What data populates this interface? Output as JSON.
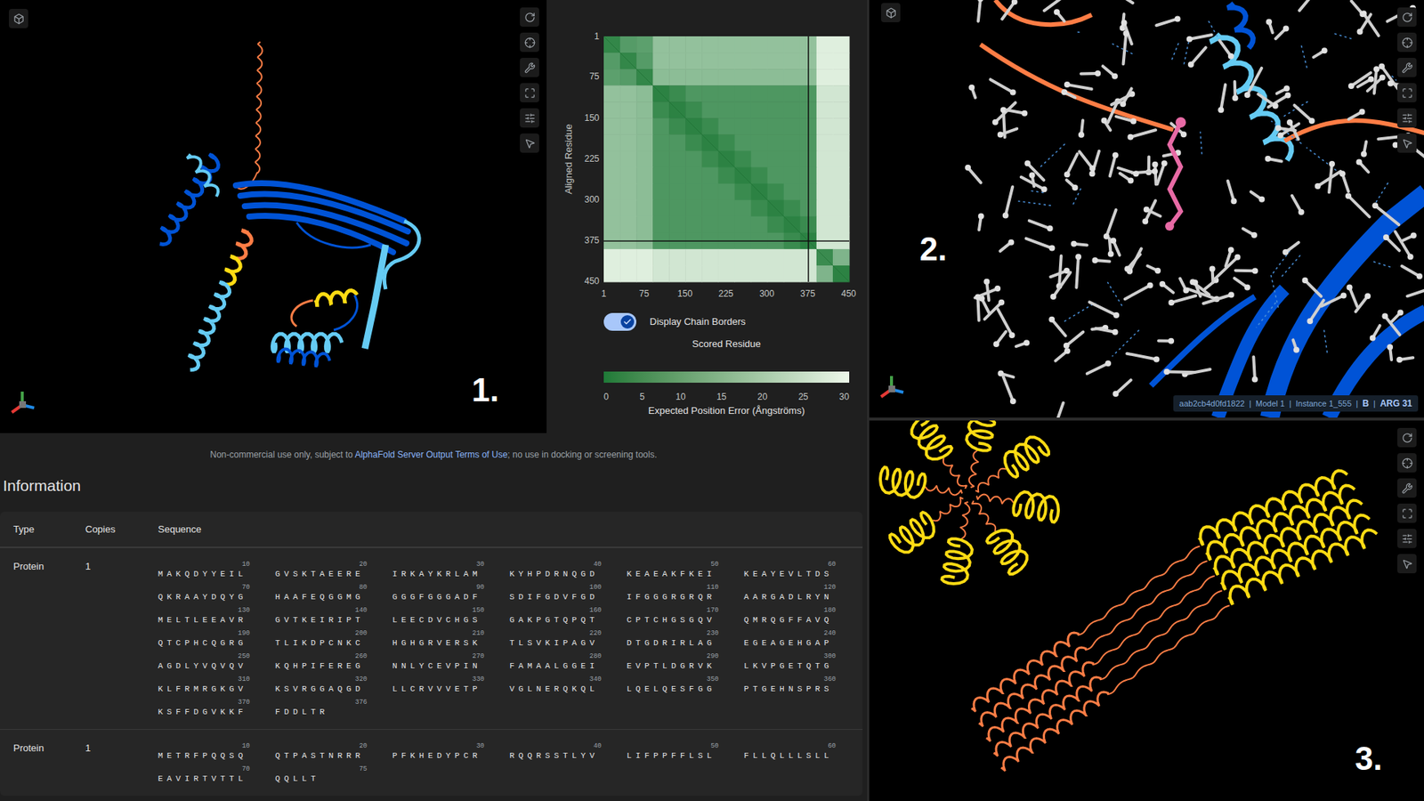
{
  "panels": [
    {
      "label": "1."
    },
    {
      "label": "2.",
      "status": {
        "separator": "|",
        "items": [
          {
            "text": "aab2cb4d0fd1822",
            "bold": false
          },
          {
            "text": "Model 1",
            "bold": false
          },
          {
            "text": "Instance 1_555",
            "bold": false
          },
          {
            "text": "B",
            "bold": true
          },
          {
            "text": "ARG 31",
            "bold": true
          }
        ]
      }
    },
    {
      "label": "3."
    }
  ],
  "pae_chart": {
    "y_label": "Aligned Residue",
    "x_label": "Scored Residue",
    "y_ticks": [
      "1",
      "75",
      "150",
      "225",
      "300",
      "375",
      "450"
    ],
    "x_ticks": [
      "1",
      "75",
      "150",
      "225",
      "300",
      "375",
      "450"
    ],
    "chain_lengths": [
      376,
      75
    ],
    "block_size": 30,
    "matrix": [
      [
        3,
        8,
        9,
        17,
        17,
        17,
        17,
        17,
        17,
        17,
        17,
        17,
        17,
        28,
        28
      ],
      [
        8,
        3,
        8,
        17,
        17,
        17,
        17,
        17,
        17,
        17,
        17,
        17,
        17,
        28,
        28
      ],
      [
        9,
        8,
        3,
        16,
        16,
        16,
        16,
        16,
        16,
        16,
        16,
        16,
        16,
        28,
        28
      ],
      [
        17,
        17,
        16,
        2,
        4,
        7,
        7,
        7,
        7,
        7,
        7,
        7,
        7,
        26,
        26
      ],
      [
        17,
        17,
        16,
        4,
        2,
        4,
        7,
        7,
        7,
        7,
        7,
        7,
        7,
        26,
        26
      ],
      [
        17,
        17,
        16,
        7,
        4,
        2,
        4,
        7,
        7,
        7,
        7,
        7,
        7,
        26,
        26
      ],
      [
        17,
        17,
        16,
        7,
        7,
        4,
        2,
        4,
        7,
        7,
        7,
        7,
        7,
        26,
        26
      ],
      [
        17,
        17,
        16,
        7,
        7,
        7,
        4,
        2,
        4,
        7,
        7,
        7,
        7,
        26,
        26
      ],
      [
        17,
        17,
        16,
        7,
        7,
        7,
        7,
        4,
        2,
        4,
        7,
        7,
        7,
        26,
        26
      ],
      [
        17,
        17,
        16,
        7,
        7,
        7,
        7,
        7,
        4,
        2,
        4,
        7,
        7,
        26,
        26
      ],
      [
        17,
        17,
        16,
        7,
        7,
        7,
        7,
        7,
        7,
        4,
        2,
        4,
        7,
        26,
        26
      ],
      [
        17,
        17,
        16,
        7,
        7,
        7,
        7,
        7,
        7,
        7,
        4,
        2,
        4,
        26,
        26
      ],
      [
        17,
        17,
        16,
        7,
        7,
        7,
        7,
        7,
        7,
        7,
        7,
        4,
        2,
        26,
        26
      ],
      [
        28,
        28,
        28,
        26,
        26,
        26,
        26,
        26,
        26,
        26,
        26,
        26,
        26,
        4,
        14
      ],
      [
        28,
        28,
        28,
        26,
        26,
        26,
        26,
        26,
        26,
        26,
        26,
        26,
        26,
        14,
        2
      ]
    ],
    "toggle": {
      "label": "Display Chain Borders",
      "on": true
    },
    "legend": {
      "ticks": [
        "0",
        "5",
        "10",
        "15",
        "20",
        "25",
        "30"
      ],
      "title": "Expected Position Error (Ångströms)"
    }
  },
  "disclaimer": {
    "before": "Non-commercial use only, subject to ",
    "link": "AlphaFold Server Output Terms of Use",
    "after": "; no use in docking or screening tools."
  },
  "information": {
    "title": "Information",
    "columns": [
      "Type",
      "Copies",
      "Sequence"
    ],
    "rows": [
      {
        "type": "Protein",
        "copies": "1",
        "groups": [
          {
            "num": "10",
            "seq": "MAKQDYYEIL"
          },
          {
            "num": "20",
            "seq": "GVSKTAEERE"
          },
          {
            "num": "30",
            "seq": "IRKAYKRLAM"
          },
          {
            "num": "40",
            "seq": "KYHPDRNQGD"
          },
          {
            "num": "50",
            "seq": "KEAEAKFKEI"
          },
          {
            "num": "60",
            "seq": "KEAYEVLTDS"
          },
          {
            "num": "70",
            "seq": "QKRAAYDQYG"
          },
          {
            "num": "80",
            "seq": "HAAFEQGGMG"
          },
          {
            "num": "90",
            "seq": "GGGFGGGADF"
          },
          {
            "num": "100",
            "seq": "SDIFGDVFGD"
          },
          {
            "num": "110",
            "seq": "IFGGGRGRQR"
          },
          {
            "num": "120",
            "seq": "AARGADLRYN"
          },
          {
            "num": "130",
            "seq": "MELTLEEAVR"
          },
          {
            "num": "140",
            "seq": "GVTKEIRIPT"
          },
          {
            "num": "150",
            "seq": "LEECDVCHGS"
          },
          {
            "num": "160",
            "seq": "GAKPGTQPQT"
          },
          {
            "num": "170",
            "seq": "CPTCHGSGQV"
          },
          {
            "num": "180",
            "seq": "QMRQGFFAVQ"
          },
          {
            "num": "190",
            "seq": "QTCPHCQGRG"
          },
          {
            "num": "200",
            "seq": "TLIKDPCNKC"
          },
          {
            "num": "210",
            "seq": "HGHGRVERSK"
          },
          {
            "num": "220",
            "seq": "TLSVKIPAGV"
          },
          {
            "num": "230",
            "seq": "DTGDRIRLAG"
          },
          {
            "num": "240",
            "seq": "EGEAGEHGAP"
          },
          {
            "num": "250",
            "seq": "AGDLYVQVQV"
          },
          {
            "num": "260",
            "seq": "KQHPIFEREG"
          },
          {
            "num": "270",
            "seq": "NNLYCEVPIN"
          },
          {
            "num": "280",
            "seq": "FAMAALGGEI"
          },
          {
            "num": "290",
            "seq": "EVPTLDGRVK"
          },
          {
            "num": "300",
            "seq": "LKVPGETQTG"
          },
          {
            "num": "310",
            "seq": "KLFRMRGKGV"
          },
          {
            "num": "320",
            "seq": "KSVRGGAQGD"
          },
          {
            "num": "330",
            "seq": "LLCRVVVETP"
          },
          {
            "num": "340",
            "seq": "VGLNERQKQL"
          },
          {
            "num": "350",
            "seq": "LQELQESFGG"
          },
          {
            "num": "360",
            "seq": "PTGEHNSPRS"
          },
          {
            "num": "370",
            "seq": "KSFFDGVKKF"
          },
          {
            "num": "376",
            "seq": "FDDLTR"
          }
        ]
      },
      {
        "type": "Protein",
        "copies": "1",
        "groups": [
          {
            "num": "10",
            "seq": "METRFPQQSQ"
          },
          {
            "num": "20",
            "seq": "QTPASTNRRR"
          },
          {
            "num": "30",
            "seq": "PFKHEDYPCR"
          },
          {
            "num": "40",
            "seq": "RQQRSSTLYV"
          },
          {
            "num": "50",
            "seq": "LIFPPFFLSL"
          },
          {
            "num": "60",
            "seq": "FLLQLLLSLL"
          },
          {
            "num": "70",
            "seq": "EAVIRTVTTL"
          },
          {
            "num": "75",
            "seq": "QQLLT"
          }
        ]
      }
    ]
  }
}
